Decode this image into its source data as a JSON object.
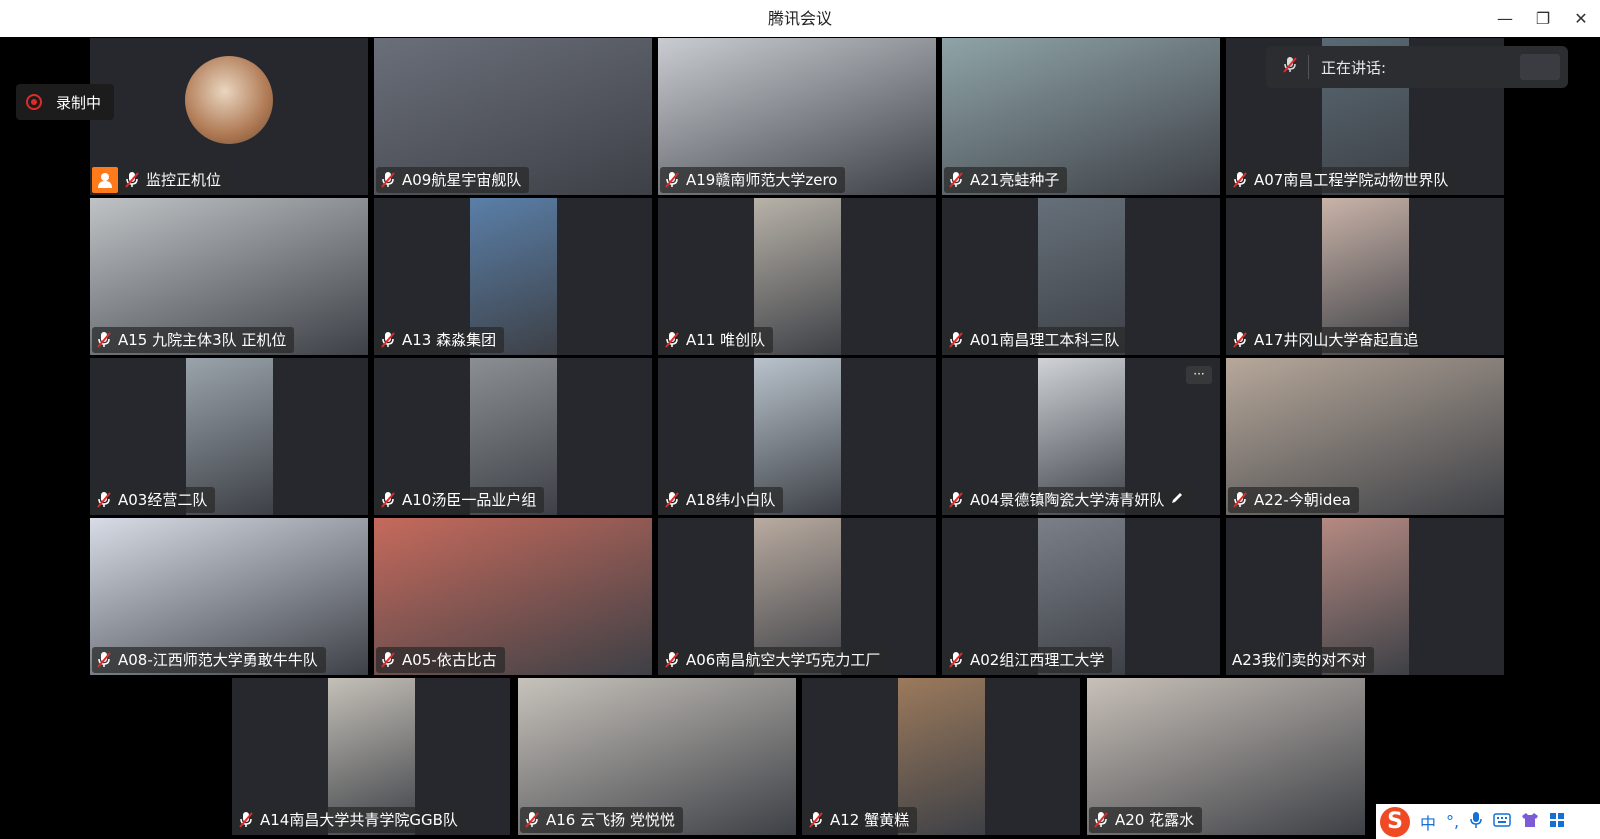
{
  "window": {
    "title": "腾讯会议",
    "controls": {
      "minimize": "—",
      "restore": "❐",
      "close": "✕"
    }
  },
  "recording": {
    "label": "录制中",
    "color": "#e02b2b"
  },
  "speaking": {
    "label": "正在讲话:"
  },
  "colors": {
    "tile_bg": "#26282d",
    "label_bg": "rgba(40,40,40,0.72)",
    "host_badge": "#ff7a1a",
    "mic_muted": "#e02b2b"
  },
  "participants": [
    {
      "name": "监控正机位",
      "host": true
    },
    {
      "name": "A09航星宇宙舰队"
    },
    {
      "name": "A19赣南师范大学zero"
    },
    {
      "name": "A21亮蛙种子"
    },
    {
      "name": "A07南昌工程学院动物世界队"
    },
    {
      "name": "A15 九院主体3队 正机位"
    },
    {
      "name": "A13 森淼集团"
    },
    {
      "name": "A11 唯创队"
    },
    {
      "name": "A01南昌理工本科三队"
    },
    {
      "name": "A17井冈山大学奋起直追"
    },
    {
      "name": "A03经营二队"
    },
    {
      "name": "A10汤臣一品业户组"
    },
    {
      "name": "A18纬小白队"
    },
    {
      "name": "A04景德镇陶瓷大学涛青妍队",
      "editing": true
    },
    {
      "name": "A22-今朝idea"
    },
    {
      "name": "A08-江西师范大学勇敢牛牛队"
    },
    {
      "name": "A05-依古比古"
    },
    {
      "name": "A06南昌航空大学巧克力工厂"
    },
    {
      "name": "A02组江西理工大学"
    },
    {
      "name": "A23我们卖的对不对",
      "no_mic": true
    },
    {
      "name": "A14南昌大学共青学院GGB队"
    },
    {
      "name": "A16 云飞扬 党悦悦"
    },
    {
      "name": "A12 蟹黄糕"
    },
    {
      "name": "A20 花露水"
    }
  ],
  "more_menu": {
    "label": "···"
  },
  "ime": {
    "logo": "S",
    "lang": "中",
    "punct": "°,",
    "items": [
      "mic-icon",
      "keyboard-icon",
      "skin-icon",
      "grid-icon"
    ]
  }
}
